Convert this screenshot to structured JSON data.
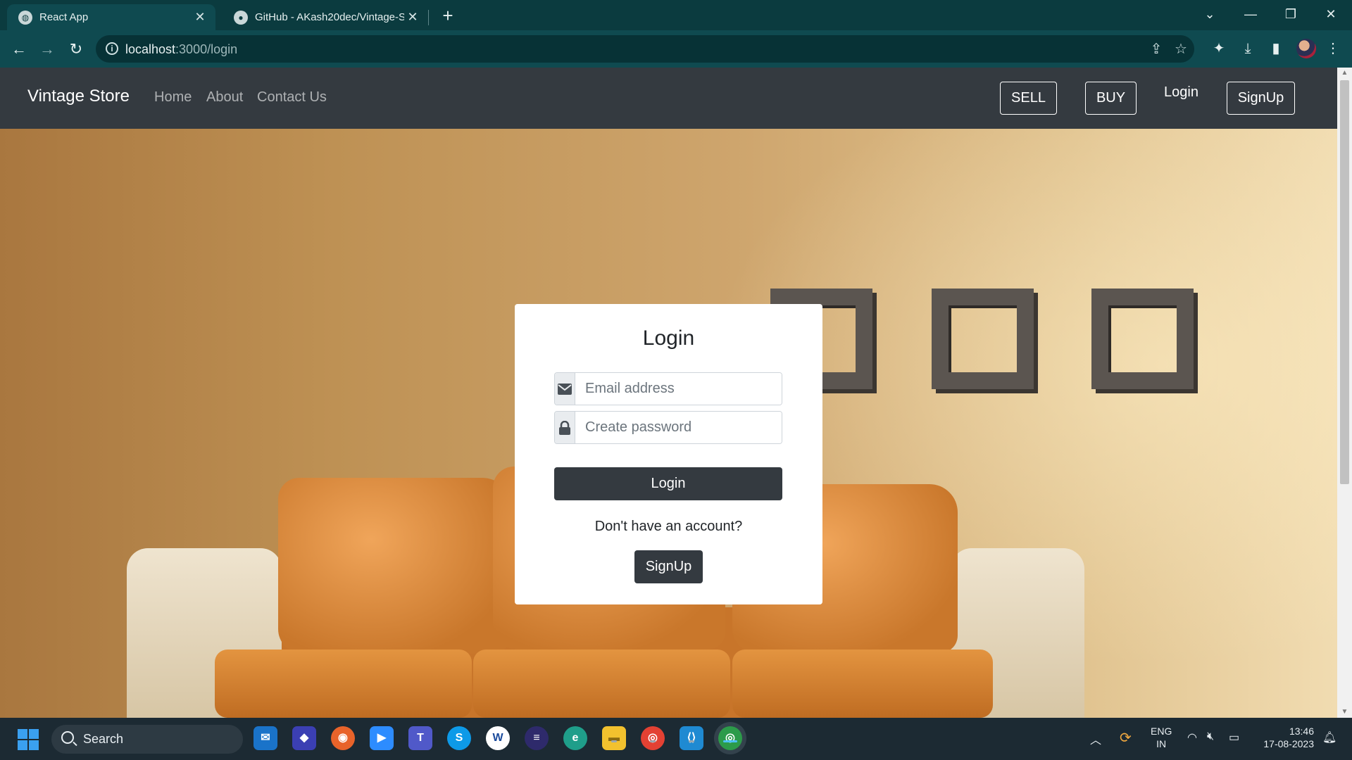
{
  "browser": {
    "tabs": [
      {
        "title": "React App",
        "icon": "globe-icon",
        "active": true
      },
      {
        "title": "GitHub - AKash20dec/Vintage-St",
        "icon": "github-icon",
        "active": false
      }
    ],
    "new_tab_label": "+",
    "address": {
      "host": "localhost",
      "path": ":3000/login"
    }
  },
  "navbar": {
    "brand": "Vintage Store",
    "links": [
      "Home",
      "About",
      "Contact Us"
    ],
    "sell_label": "SELL",
    "buy_label": "BUY",
    "login_label": "Login",
    "signup_label": "SignUp"
  },
  "login_card": {
    "title": "Login",
    "email_placeholder": "Email address",
    "password_placeholder": "Create password",
    "submit_label": "Login",
    "no_account_text": "Don't have an account?",
    "signup_label": "SignUp"
  },
  "taskbar": {
    "search_label": "Search",
    "language": "ENG",
    "region": "IN",
    "time": "13:46",
    "date": "17-08-2023"
  },
  "colors": {
    "browser_frame": "#0b3b3f",
    "navbar": "#343a40",
    "button_dark": "#343a40"
  }
}
